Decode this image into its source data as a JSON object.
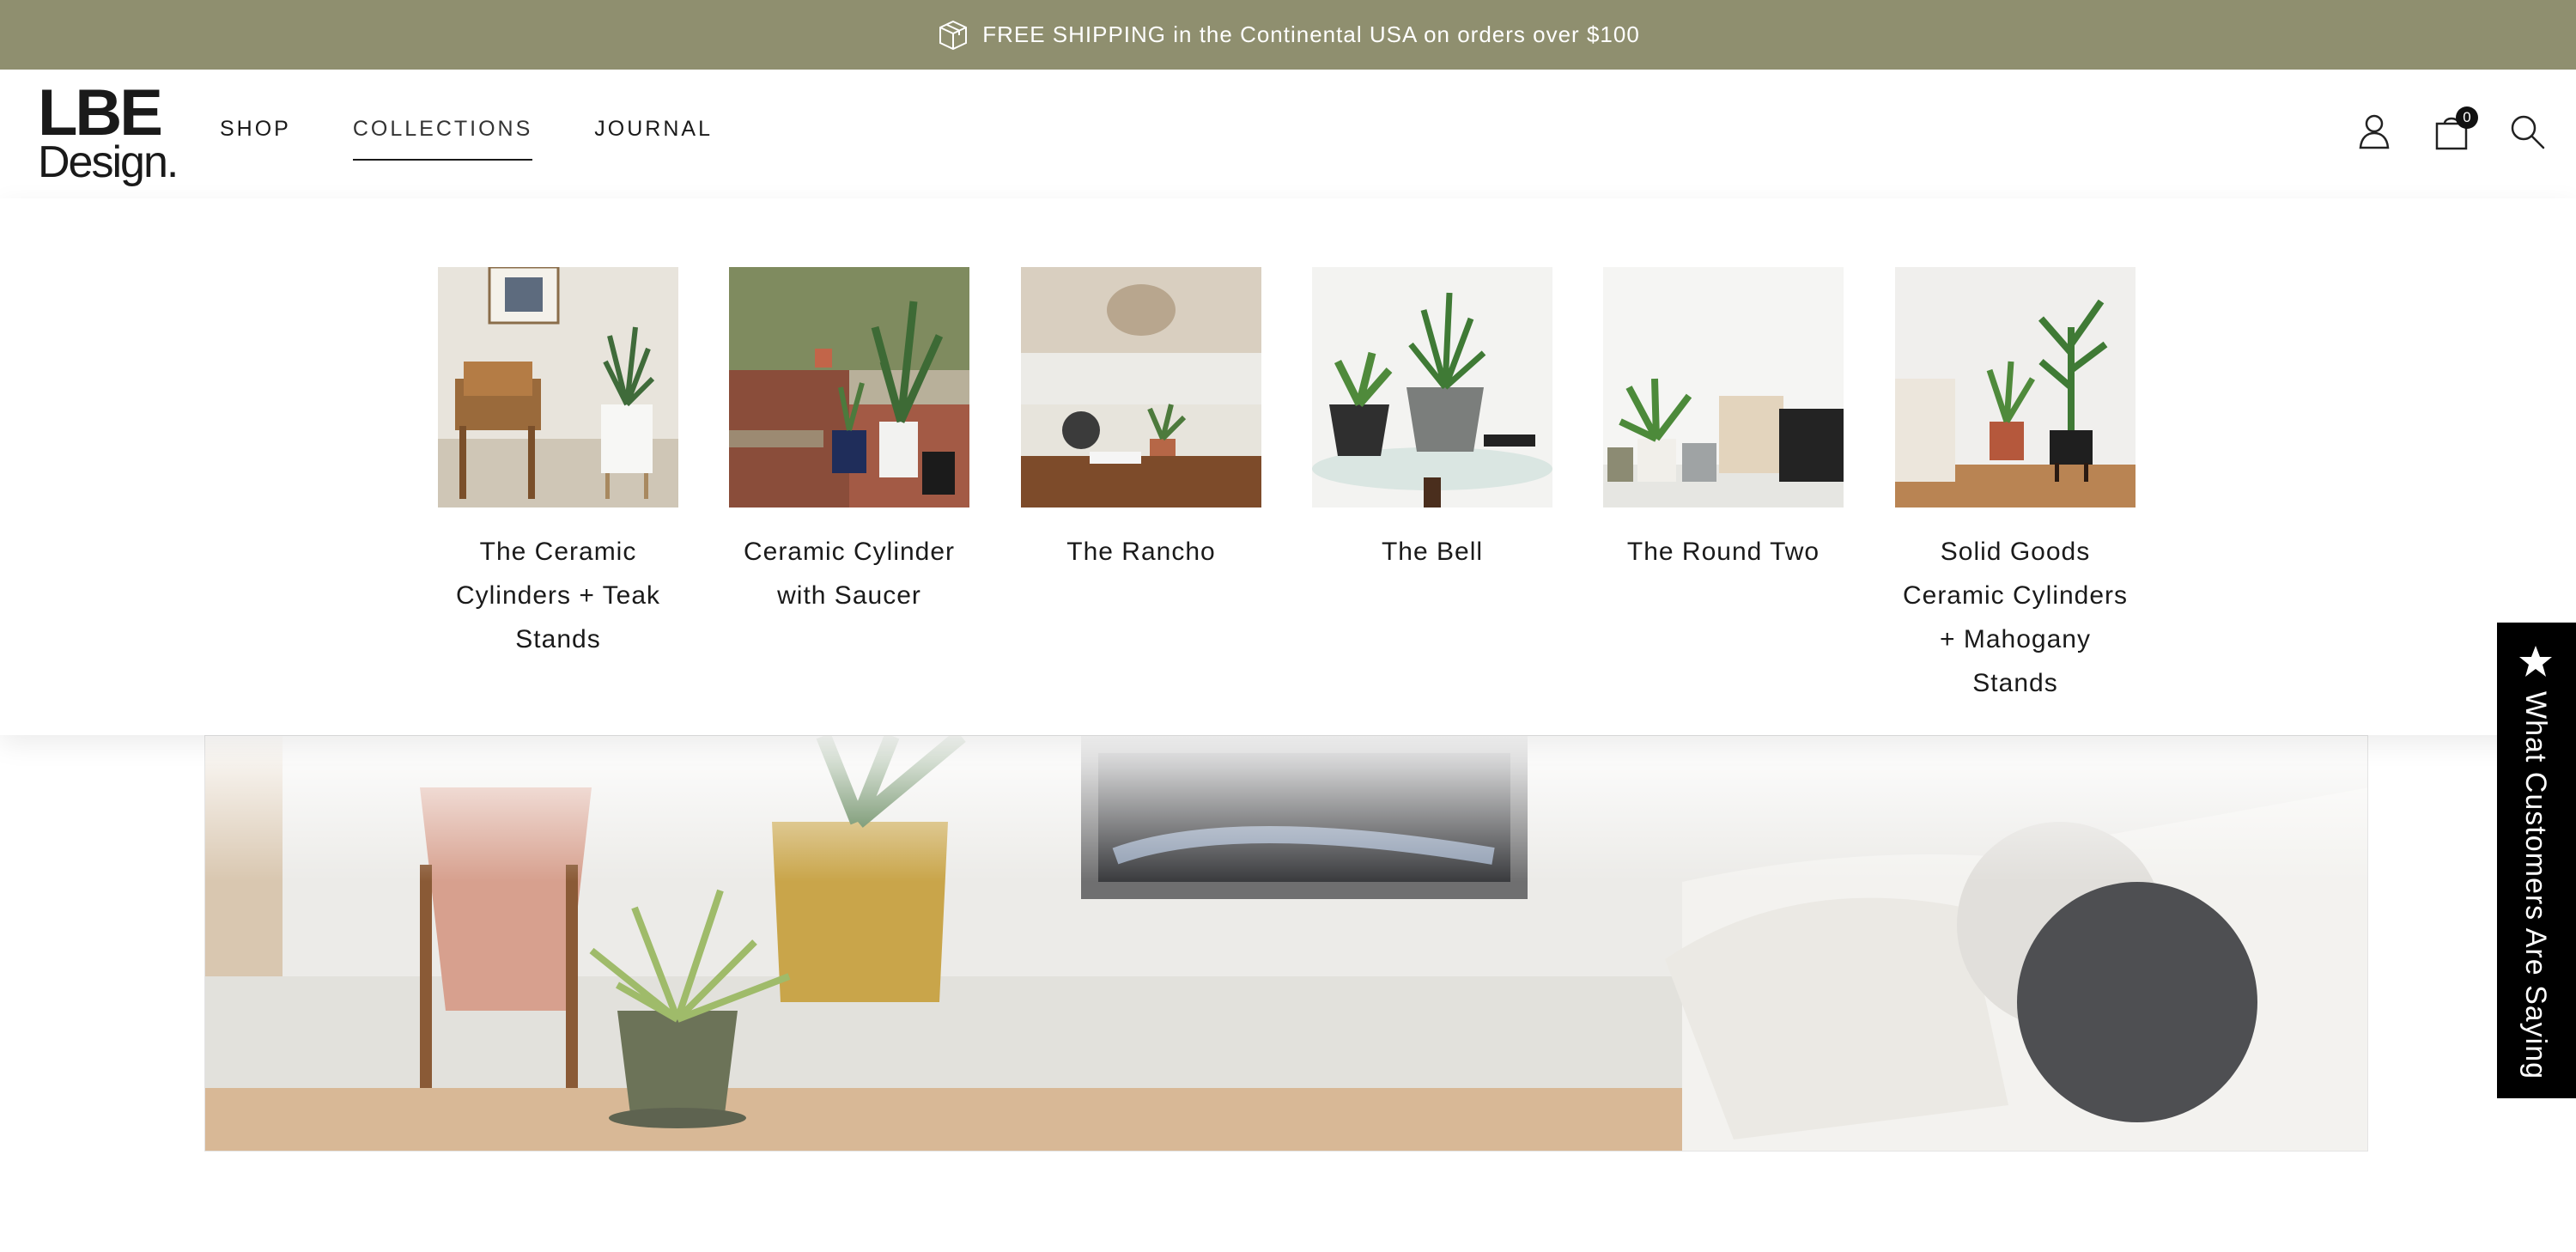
{
  "announcement": {
    "icon": "box-icon",
    "text": "FREE SHIPPING in the Continental USA on orders over $100"
  },
  "brand": {
    "logo_top": "LBE",
    "logo_bottom": "Design."
  },
  "nav": {
    "items": [
      {
        "label": "SHOP",
        "active": false
      },
      {
        "label": "COLLECTIONS",
        "active": true
      },
      {
        "label": "JOURNAL",
        "active": false
      }
    ]
  },
  "header_icons": {
    "account": "user-icon",
    "cart": "bag-icon",
    "cart_count": "0",
    "search": "search-icon"
  },
  "collections": [
    {
      "label": "The Ceramic Cylinders + Teak Stands"
    },
    {
      "label": "Ceramic Cylinder with Saucer"
    },
    {
      "label": "The Rancho"
    },
    {
      "label": "The Bell"
    },
    {
      "label": "The Round Two"
    },
    {
      "label": "Solid Goods Ceramic Cylinders + Mahogany Stands"
    }
  ],
  "reviews_tab": {
    "icon": "star-icon",
    "text": "What Customers Are Saying"
  },
  "colors": {
    "announcement_bg": "#8f8f6f",
    "reviews_tab_bg": "#000000"
  }
}
